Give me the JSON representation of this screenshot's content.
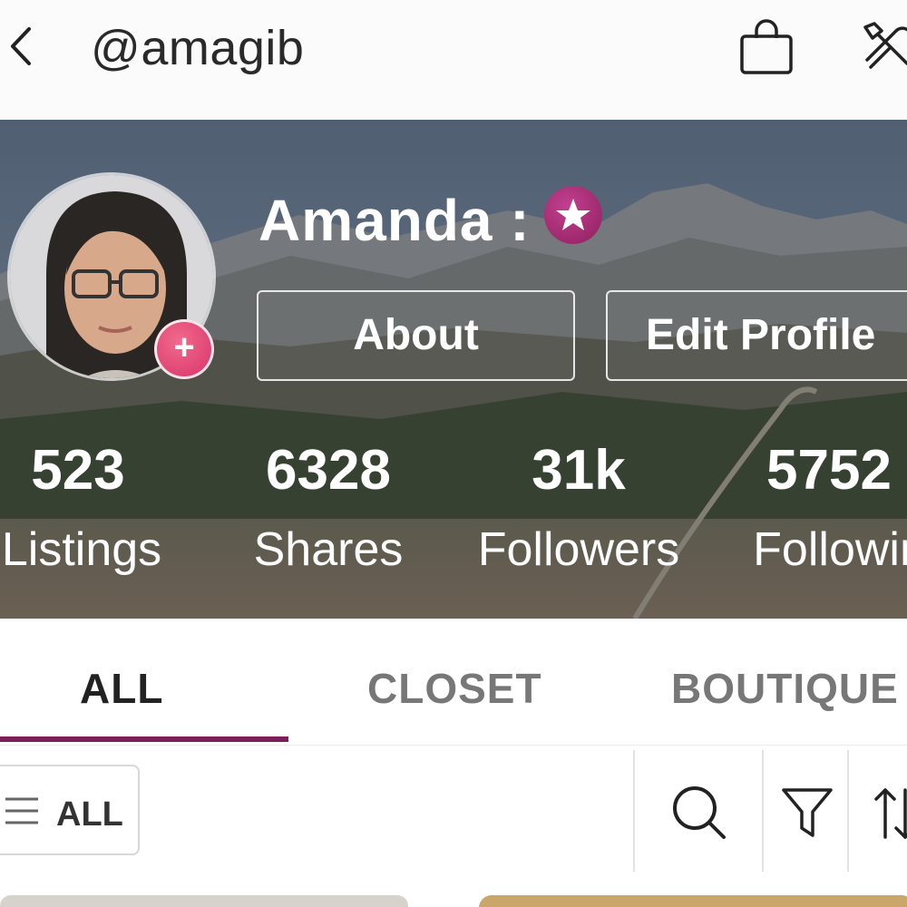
{
  "header": {
    "handle": "@amagib"
  },
  "profile": {
    "name": "Amanda :",
    "about_label": "About",
    "edit_label": "Edit Profile",
    "add_photo_symbol": "+"
  },
  "stats": [
    {
      "value": "523",
      "label": "Listings"
    },
    {
      "value": "6328",
      "label": "Shares"
    },
    {
      "value": "31k",
      "label": "Followers"
    },
    {
      "value": "5752",
      "label": "Following"
    }
  ],
  "tabs": {
    "all": "ALL",
    "closet": "CLOSET",
    "boutique": "BOUTIQUE",
    "active": "ALL"
  },
  "filters": {
    "category_label": "ALL"
  },
  "icons": {
    "back": "chevron-left-icon",
    "bag": "shopping-bag-icon",
    "tools": "tools-icon",
    "star": "star-badge-icon",
    "menu": "menu-icon",
    "search": "search-icon",
    "filter": "filter-icon",
    "sort": "sort-icon"
  },
  "colors": {
    "accent": "#7a1f5c",
    "badge": "#a02a72",
    "add_photo": "#e0457a",
    "text_dark": "#2b2b2b",
    "tab_inactive": "#777777"
  }
}
